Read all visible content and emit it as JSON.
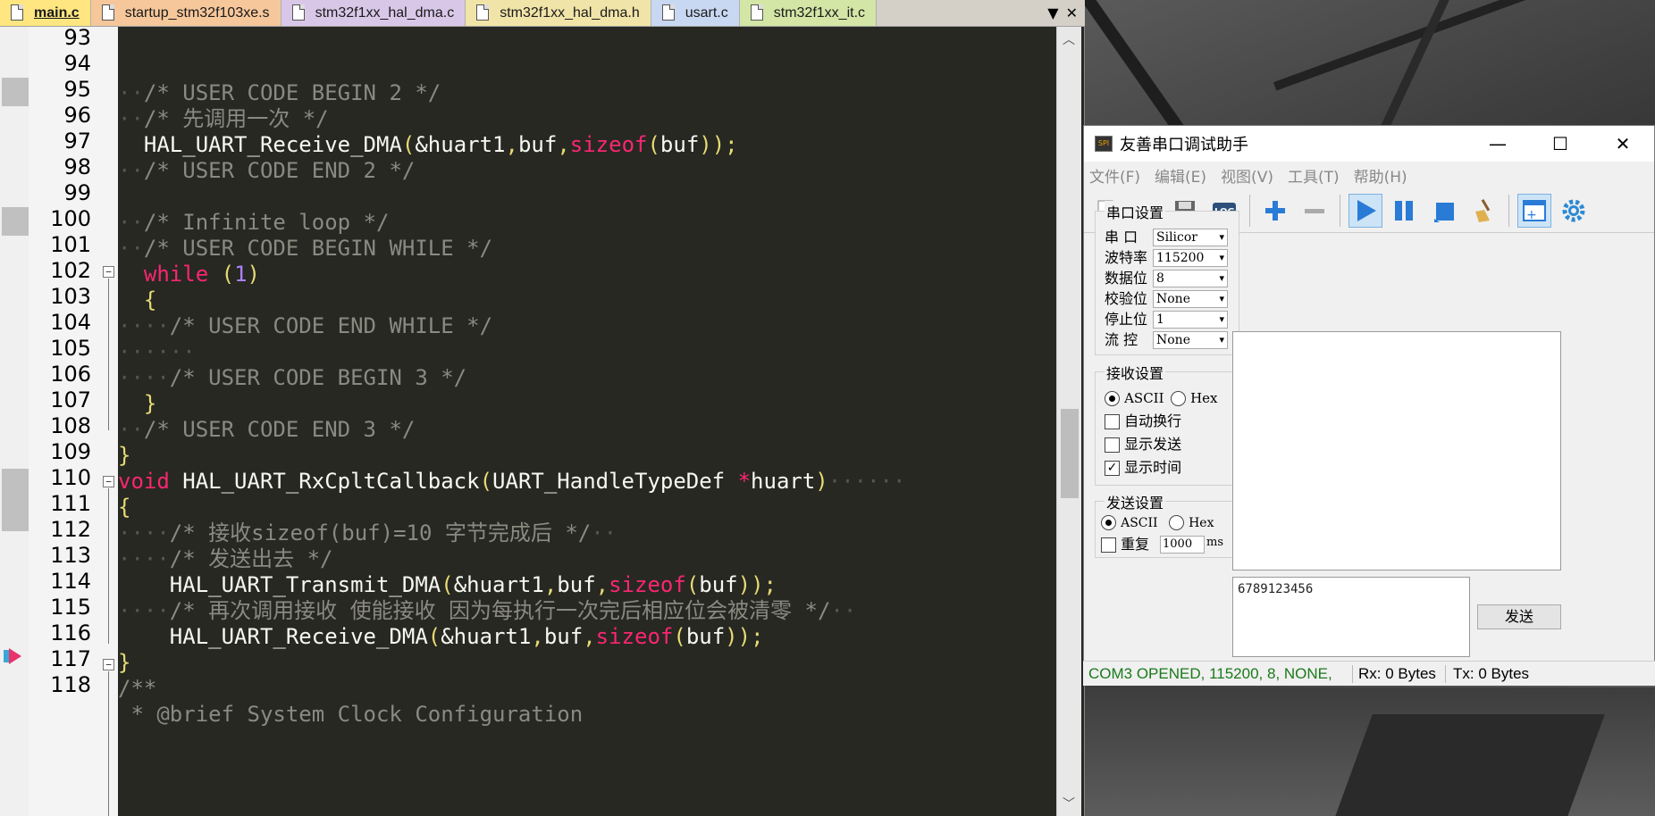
{
  "editor": {
    "tabs": [
      {
        "label": "main.c"
      },
      {
        "label": "startup_stm32f103xe.s"
      },
      {
        "label": "stm32f1xx_hal_dma.c"
      },
      {
        "label": "stm32f1xx_hal_dma.h"
      },
      {
        "label": "usart.c"
      },
      {
        "label": "stm32f1xx_it.c"
      }
    ],
    "tab_menu_glyph": "▼",
    "tab_close_glyph": "✕",
    "line_numbers": [
      "93",
      "94",
      "95",
      "96",
      "97",
      "98",
      "99",
      "100",
      "101",
      "102",
      "103",
      "104",
      "105",
      "106",
      "107",
      "108",
      "109",
      "110",
      "111",
      "112",
      "113",
      "114",
      "115",
      "116",
      "117",
      "118"
    ],
    "code": {
      "l94": "/* USER CODE BEGIN 2 */",
      "l95": "/* 先调用一次 */",
      "l96_fn": "HAL_UART_Receive_DMA",
      "l96_args1": "&huart1",
      "l96_args2": "buf",
      "l96_kw": "sizeof",
      "l96_arg3": "buf",
      "l97": "/* USER CODE END 2 */",
      "l99": "/* Infinite loop */",
      "l100": "/* USER CODE BEGIN WHILE */",
      "l101_kw": "while",
      "l101_num": "1",
      "l103": "/* USER CODE END WHILE */",
      "l105": "/* USER CODE BEGIN 3 */",
      "l107": "/* USER CODE END 3 */",
      "l109_kw": "void",
      "l109_fn": "HAL_UART_RxCpltCallback",
      "l109_type": "UART_HandleTypeDef",
      "l109_ptr": "*",
      "l109_param": "huart",
      "l111": "/* 接收sizeof(buf)=10 字节完成后 */",
      "l112": "/* 发送出去 */",
      "l113_fn": "HAL_UART_Transmit_DMA",
      "l114": "/* 再次调用接收 使能接收 因为每执行一次完后相应位会被清零 */",
      "l115_fn": "HAL_UART_Receive_DMA",
      "l117": "/**",
      "l118": " * @brief System Clock Configuration"
    }
  },
  "serial": {
    "title": "友善串口调试助手",
    "win_min": "—",
    "win_max": "☐",
    "win_close": "✕",
    "menu": [
      "文件(F)",
      "编辑(E)",
      "视图(V)",
      "工具(T)",
      "帮助(H)"
    ],
    "toolbar": [
      "new-file-icon",
      "open-file-icon",
      "save-icon",
      "log-icon",
      "add-icon",
      "remove-icon",
      "play-icon",
      "pause-icon",
      "stop-icon",
      "clear-broom-icon",
      "add-window-icon",
      "settings-gear-icon"
    ],
    "log_label": "LOG",
    "port_group": {
      "title": "串口设置",
      "port_label": "串 口",
      "port_value": "Silicor",
      "baud_label": "波特率",
      "baud_value": "115200",
      "data_label": "数据位",
      "data_value": "8",
      "parity_label": "校验位",
      "parity_value": "None",
      "stop_label": "停止位",
      "stop_value": "1",
      "flow_label": "流 控",
      "flow_value": "None"
    },
    "rx_group": {
      "title": "接收设置",
      "ascii": "ASCII",
      "hex": "Hex",
      "wrap": "自动换行",
      "show_send": "显示发送",
      "show_time": "显示时间"
    },
    "tx_group": {
      "title": "发送设置",
      "ascii": "ASCII",
      "hex": "Hex",
      "repeat": "重复",
      "interval": "1000",
      "unit": "ms"
    },
    "tx_text": "6789123456",
    "send_button": "发送",
    "history_value": "6789123456",
    "status": {
      "conn": "COM3 OPENED, 115200, 8, NONE,",
      "rx": "Rx: 0 Bytes",
      "tx": "Tx: 0 Bytes"
    }
  },
  "colors": {
    "editor_bg": "#272822",
    "comment": "#8a8a80",
    "keyword": "#f92672",
    "paren": "#e6db74",
    "number": "#ae81ff",
    "status_green": "#1a7a1a"
  }
}
